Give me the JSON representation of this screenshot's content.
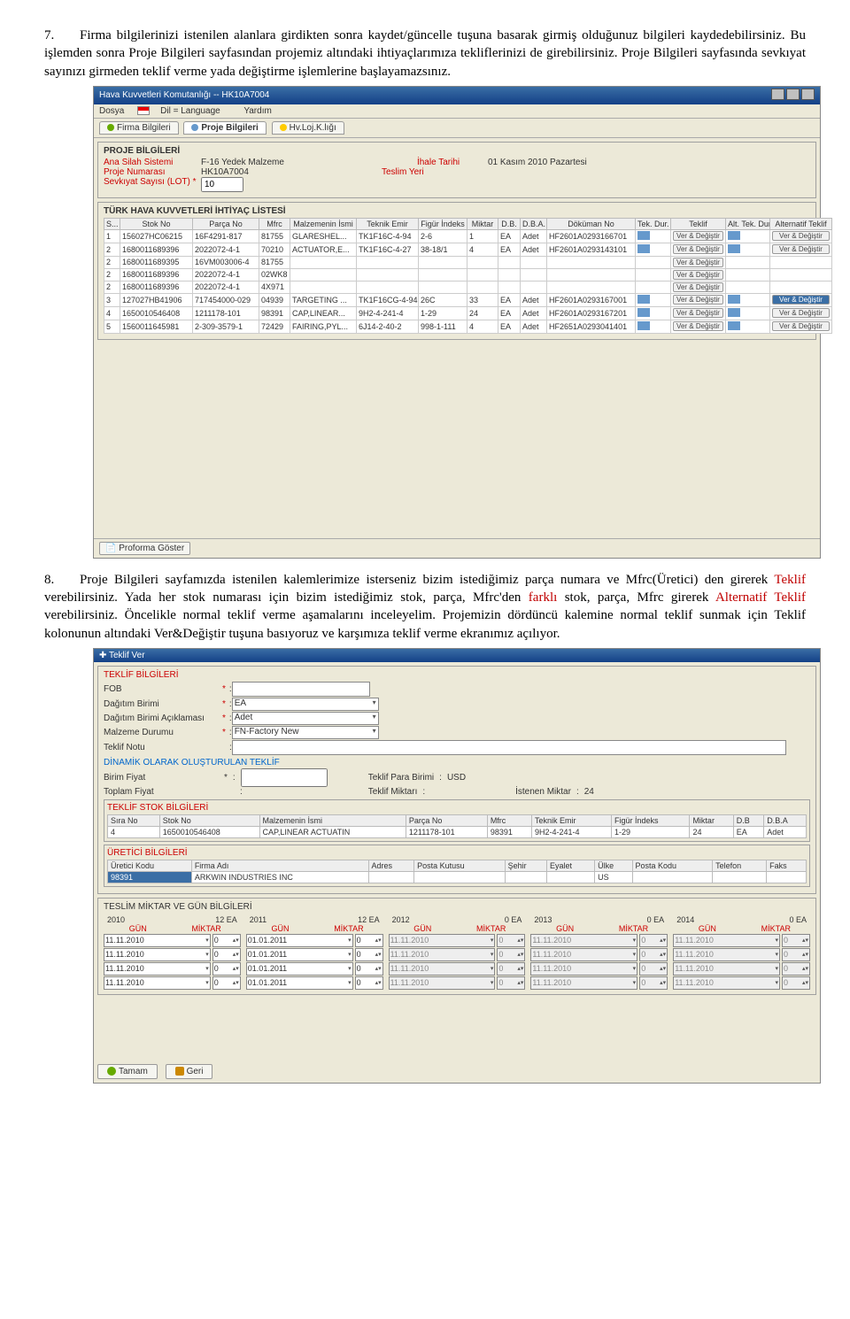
{
  "para7_num": "7.",
  "para7_text": "Firma bilgilerinizi istenilen alanlara girdikten sonra kaydet/güncelle tuşuna basarak girmiş olduğunuz bilgileri kaydedebilirsiniz. Bu işlemden sonra Proje Bilgileri sayfasından projemiz altındaki ihtiyaçlarımıza tekliflerinizi de girebilirsiniz. Proje Bilgileri sayfasında sevkıyat sayınızı girmeden teklif verme yada değiştirme işlemlerine başlayamazsınız.",
  "para8_num": "8.",
  "para8_pre": "Proje Bilgileri sayfamızda istenilen kalemlerimize isterseniz bizim istediğimiz parça numara ve Mfrc(Üretici) den girerek ",
  "para8_red1": "Teklif",
  "para8_mid1": " verebilirsiniz. Yada her stok numarası için bizim istediğimiz stok, parça, Mfrc'den ",
  "para8_red2": "farklı",
  "para8_mid2": " stok, parça, Mfrc girerek ",
  "para8_red3": "Alternatif Teklif",
  "para8_post": " verebilirsiniz. Öncelikle normal teklif verme aşamalarını inceleyelim. Projemizin dördüncü kalemine normal teklif sunmak için Teklif kolonunun altındaki Ver&Değiştir tuşuna basıyoruz ve karşımıza teklif verme ekranımız açılıyor.",
  "shot1": {
    "title": "Hava Kuvvetleri Komutanlığı -- HK10A7004",
    "menu": {
      "dosya": "Dosya",
      "dil": "Dil = Language",
      "yardim": "Yardım"
    },
    "tabs": {
      "firma": "Firma Bilgileri",
      "proje": "Proje Bilgileri",
      "hv": "Hv.Loj.K.lığı"
    },
    "proje_legend": "PROJE BİLGİLERİ",
    "fields": {
      "ana_silah_k": "Ana Silah Sistemi",
      "ana_silah_v": "F-16 Yedek Malzeme",
      "proje_no_k": "Proje Numarası",
      "proje_no_v": "HK10A7004",
      "sevk_k": "Sevkıyat Sayısı (LOT) *",
      "sevk_v": "10",
      "ihale_k": "İhale Tarihi",
      "ihale_v": "01 Kasım 2010 Pazartesi",
      "teslim_k": "Teslim Yeri",
      "teslim_v": ""
    },
    "liste_legend": "TÜRK HAVA KUVVETLERİ İHTİYAÇ LİSTESİ",
    "cols": [
      "S...",
      "Stok No",
      "Parça No",
      "Mfrc",
      "Malzemenin İsmi",
      "Teknik Emir",
      "Figür İndeks",
      "Miktar",
      "D.B.",
      "D.B.A.",
      "Döküman No",
      "Tek. Dur.",
      "Teklif",
      "Alt. Tek. Dur.",
      "Alternatif Teklif"
    ],
    "rows": [
      {
        "s": "1",
        "stok": "156027HC06215",
        "parca": "16F4291-817",
        "mfrc": "81755",
        "isim": "GLARESHEL...",
        "emir": "TK1F16C-4-94",
        "fig": "2-6",
        "mik": "1",
        "db": "EA",
        "dba": "Adet",
        "dok": "HF2601A0293166701",
        "btn": "Ver & Değiştir",
        "abtn": "Ver & Değiştir"
      },
      {
        "s": "2",
        "stok": "1680011689396",
        "parca": "2022072-4-1",
        "mfrc": "70210",
        "isim": "ACTUATOR,E...",
        "emir": "TK1F16C-4-27",
        "fig": "38-18/1",
        "mik": "4",
        "db": "EA",
        "dba": "Adet",
        "dok": "HF2601A0293143101",
        "btn": "Ver & Değiştir",
        "abtn": "Ver & Değiştir"
      },
      {
        "s": "2",
        "stok": "1680011689395",
        "parca": "16VM003006-4",
        "mfrc": "81755",
        "isim": "",
        "emir": "",
        "fig": "",
        "mik": "",
        "db": "",
        "dba": "",
        "dok": "",
        "btn": "Ver & Değiştir",
        "abtn": ""
      },
      {
        "s": "2",
        "stok": "1680011689396",
        "parca": "2022072-4-1",
        "mfrc": "02WK8",
        "isim": "",
        "emir": "",
        "fig": "",
        "mik": "",
        "db": "",
        "dba": "",
        "dok": "",
        "btn": "Ver & Değiştir",
        "abtn": ""
      },
      {
        "s": "2",
        "stok": "1680011689396",
        "parca": "2022072-4-1",
        "mfrc": "4X971",
        "isim": "",
        "emir": "",
        "fig": "",
        "mik": "",
        "db": "",
        "dba": "",
        "dok": "",
        "btn": "Ver & Değiştir",
        "abtn": ""
      },
      {
        "s": "3",
        "stok": "127027HB41906",
        "parca": "717454000-029",
        "mfrc": "04939",
        "isim": "TARGETING ...",
        "emir": "TK1F16CG-4-94",
        "fig": "26C",
        "mik": "33",
        "db": "EA",
        "dba": "Adet",
        "dok": "HF2601A0293167001",
        "btn": "Ver & Değiştir",
        "abtn": "Ver & Değiştir",
        "altsel": true
      },
      {
        "s": "4",
        "stok": "1650010546408",
        "parca": "1211178-101",
        "mfrc": "98391",
        "isim": "CAP,LINEAR...",
        "emir": "9H2-4-241-4",
        "fig": "1-29",
        "mik": "24",
        "db": "EA",
        "dba": "Adet",
        "dok": "HF2601A0293167201",
        "btn": "Ver & Değiştir",
        "abtn": "Ver & Değiştir"
      },
      {
        "s": "5",
        "stok": "1560011645981",
        "parca": "2-309-3579-1",
        "mfrc": "72429",
        "isim": "FAIRING,PYL...",
        "emir": "6J14-2-40-2",
        "fig": "998-1-111",
        "mik": "4",
        "db": "EA",
        "dba": "Adet",
        "dok": "HF2651A0293041401",
        "btn": "Ver & Değiştir",
        "abtn": "Ver & Değiştir"
      }
    ],
    "footer_btn": "Proforma Göster"
  },
  "shot2": {
    "title": "Teklif Ver",
    "legend1": "TEKLİF BİLGİLERİ",
    "f": {
      "fob": "FOB",
      "dag": "Dağıtım Birimi",
      "dag_v": "EA",
      "daga": "Dağıtım Birimi Açıklaması",
      "daga_v": "Adet",
      "malz": "Malzeme Durumu",
      "malz_v": "FN-Factory New",
      "notu": "Teklif Notu"
    },
    "dyn_legend": "DİNAMİK OLARAK OLUŞTURULAN TEKLİF",
    "dyn": {
      "birim": "Birim Fiyat",
      "para": "Teklif Para Birimi",
      "para_v": "USD",
      "toplam": "Toplam Fiyat",
      "tmik": "Teklif Miktarı",
      "istenen": "İstenen Miktar",
      "istenen_v": "24"
    },
    "stok_legend": "TEKLİF STOK BİLGİLERİ",
    "stok_cols": [
      "Sıra No",
      "Stok No",
      "Malzemenin İsmi",
      "Parça No",
      "Mfrc",
      "Teknik Emir",
      "Figür İndeks",
      "Miktar",
      "D.B",
      "D.B.A"
    ],
    "stok_row": {
      "sira": "4",
      "stok": "1650010546408",
      "isim": "CAP,LINEAR ACTUATIN",
      "parca": "1211178-101",
      "mfrc": "98391",
      "emir": "9H2-4-241-4",
      "fig": "1-29",
      "mik": "24",
      "db": "EA",
      "dba": "Adet"
    },
    "uret_legend": "ÜRETİCİ BİLGİLERİ",
    "uret_cols": [
      "Üretici Kodu",
      "Firma Adı",
      "Adres",
      "Posta Kutusu",
      "Şehir",
      "Eyalet",
      "Ülke",
      "Posta Kodu",
      "Telefon",
      "Faks"
    ],
    "uret_row": {
      "kod": "98391",
      "ad": "ARKWIN INDUSTRIES INC",
      "adres": "",
      "pk": "",
      "sehir": "",
      "ey": "",
      "ulke": "US",
      "pkod": "",
      "tel": "",
      "faks": ""
    },
    "teslim_legend": "TESLİM MİKTAR VE GÜN BİLGİLERİ",
    "years": [
      {
        "y": "2010",
        "ea": "12 EA",
        "rows": [
          [
            "11.11.2010",
            "0"
          ],
          [
            "11.11.2010",
            "0"
          ],
          [
            "11.11.2010",
            "0"
          ],
          [
            "11.11.2010",
            "0"
          ]
        ],
        "active": true
      },
      {
        "y": "2011",
        "ea": "12 EA",
        "rows": [
          [
            "01.01.2011",
            "0"
          ],
          [
            "01.01.2011",
            "0"
          ],
          [
            "01.01.2011",
            "0"
          ],
          [
            "01.01.2011",
            "0"
          ]
        ],
        "active": true
      },
      {
        "y": "2012",
        "ea": "0 EA",
        "rows": [
          [
            "11.11.2010",
            "0"
          ],
          [
            "11.11.2010",
            "0"
          ],
          [
            "11.11.2010",
            "0"
          ],
          [
            "11.11.2010",
            "0"
          ]
        ],
        "active": false
      },
      {
        "y": "2013",
        "ea": "0 EA",
        "rows": [
          [
            "11.11.2010",
            "0"
          ],
          [
            "11.11.2010",
            "0"
          ],
          [
            "11.11.2010",
            "0"
          ],
          [
            "11.11.2010",
            "0"
          ]
        ],
        "active": false
      },
      {
        "y": "2014",
        "ea": "0 EA",
        "rows": [
          [
            "11.11.2010",
            "0"
          ],
          [
            "11.11.2010",
            "0"
          ],
          [
            "11.11.2010",
            "0"
          ],
          [
            "11.11.2010",
            "0"
          ]
        ],
        "active": false
      }
    ],
    "gun": "GÜN",
    "miktar": "MİKTAR",
    "tamam": "Tamam",
    "geri": "Geri"
  }
}
